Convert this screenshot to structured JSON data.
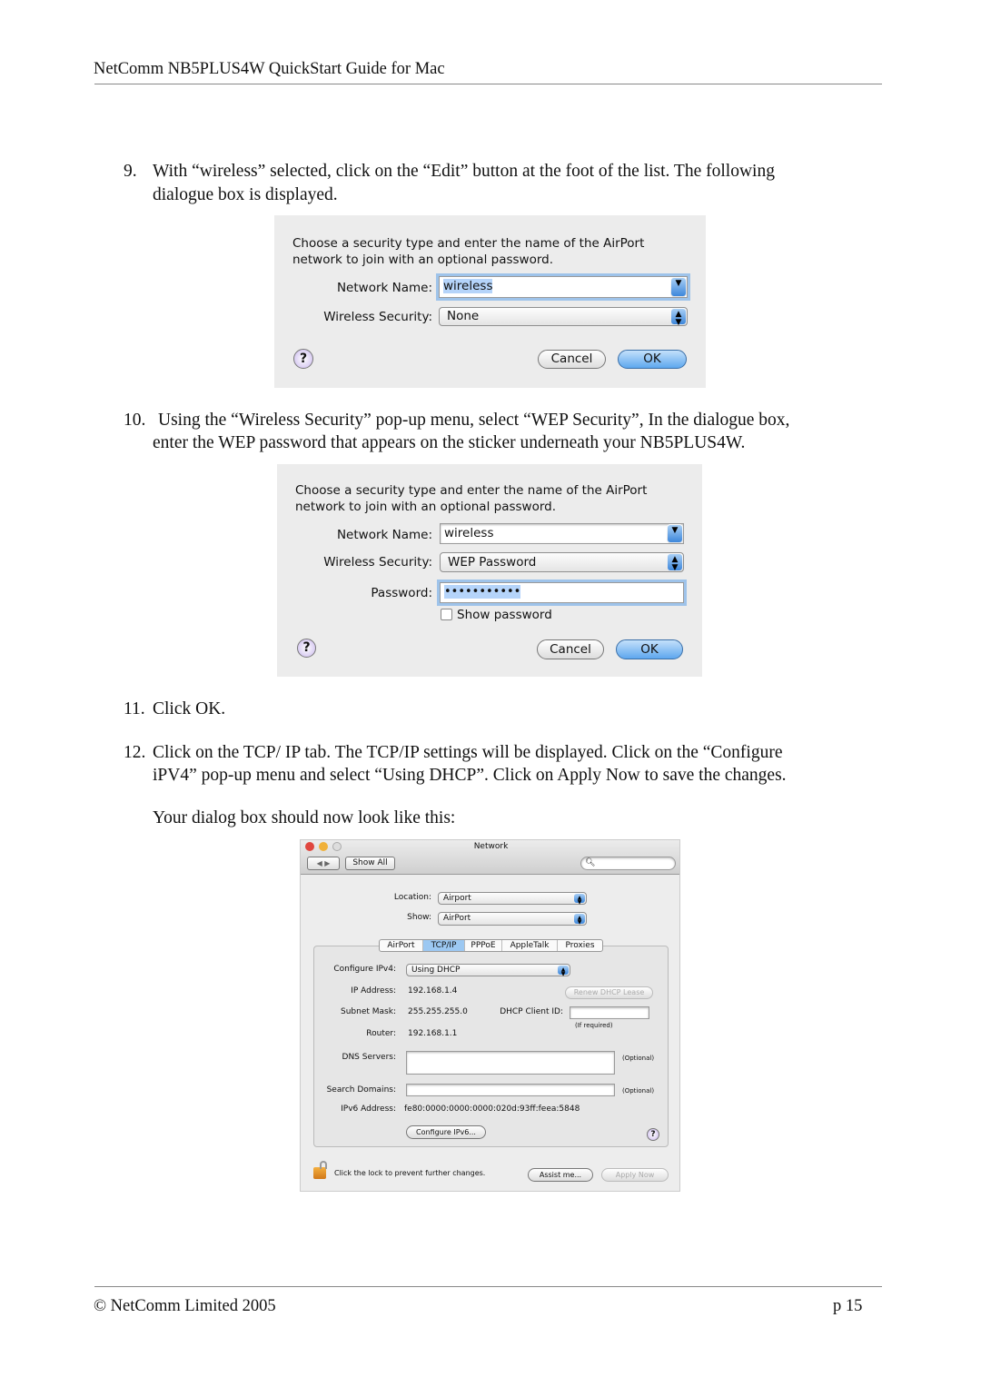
{
  "header": {
    "title": "NetComm NB5PLUS4W QuickStart Guide for Mac"
  },
  "steps": [
    {
      "num": "9.",
      "lines": [
        "With “wireless” selected, click on the “Edit” button at the foot of the list. The following",
        "dialogue box is displayed."
      ]
    },
    {
      "num": "10.",
      "lines": [
        "Using the “Wireless Security” pop-up menu, select “WEP Security”, In the dialogue box,",
        "enter the WEP password that appears on the sticker underneath your NB5PLUS4W."
      ]
    },
    {
      "num": "11.",
      "lines": [
        "Click OK."
      ]
    },
    {
      "num": "12.",
      "lines": [
        "Click on the TCP/ IP tab. The TCP/IP settings will be displayed. Click on the “Configure",
        "iPV4” pop-up menu and select “Using DHCP”.  Click on Apply Now to save the changes."
      ]
    }
  ],
  "note": "Your dialog box should now look like this:",
  "dialog1": {
    "intro": [
      "Choose a security type and enter the name of the AirPort",
      "network to join with an optional password."
    ],
    "network_name_label": "Network Name:",
    "network_name": "wireless",
    "security_label": "Wireless Security:",
    "security": "None",
    "cancel": "Cancel",
    "ok": "OK",
    "help": "?"
  },
  "dialog2": {
    "intro": [
      "Choose a security type and enter the name of the AirPort",
      "network to join with an optional password."
    ],
    "network_name_label": "Network Name:",
    "network_name": "wireless",
    "security_label": "Wireless Security:",
    "security": "WEP Password",
    "password_label": "Password:",
    "password": "•••••••••••",
    "show_password": "Show password",
    "cancel": "Cancel",
    "ok": "OK",
    "help": "?"
  },
  "dialog3": {
    "title": "Network",
    "show_all": "Show All",
    "location_label": "Location:",
    "location": "Airport",
    "show_label": "Show:",
    "show": "AirPort",
    "tabs": [
      {
        "label": "AirPort"
      },
      {
        "label": "TCP/IP",
        "active": true
      },
      {
        "label": "PPPoE"
      },
      {
        "label": "AppleTalk"
      },
      {
        "label": "Proxies"
      }
    ],
    "configure_ipv4_label": "Configure IPv4:",
    "configure_ipv4": "Using DHCP",
    "ip_label": "IP Address:",
    "ip": "192.168.1.4",
    "renew": "Renew DHCP Lease",
    "subnet_label": "Subnet Mask:",
    "subnet": "255.255.255.0",
    "client_id_label": "DHCP Client ID:",
    "if_required": "(If required)",
    "router_label": "Router:",
    "router": "192.168.1.1",
    "dns_label": "DNS Servers:",
    "search_label": "Search Domains:",
    "optional": "(Optional)",
    "ipv6_label": "IPv6 Address:",
    "ipv6": "fe80:0000:0000:0000:020d:93ff:feea:5848",
    "configure_ipv6": "Configure IPv6...",
    "lock_text": "Click the lock to prevent further changes.",
    "assist": "Assist me...",
    "apply": "Apply Now",
    "help": "?"
  },
  "footer": {
    "copyright": "© NetComm Limited 2005",
    "page": "p 15"
  }
}
